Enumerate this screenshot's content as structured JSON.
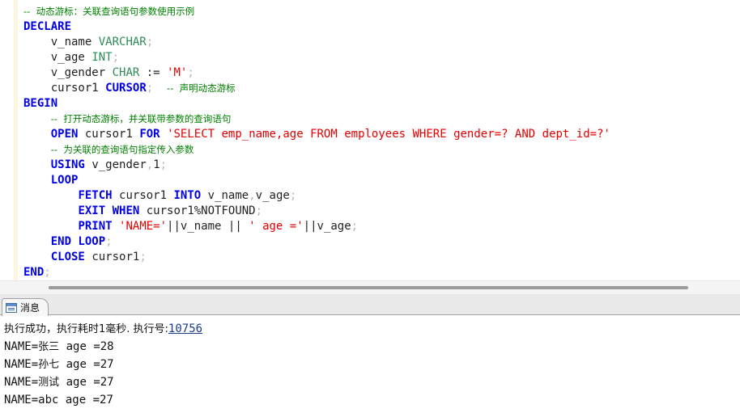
{
  "editor": {
    "lines": [
      "-- 动态游标：关联查询语句参数使用示例",
      "DECLARE",
      "    v_name VARCHAR;",
      "    v_age INT;",
      "    v_gender CHAR := 'M';",
      "    cursor1 CURSOR;  -- 声明动态游标",
      "BEGIN",
      "    -- 打开动态游标，并关联带参数的查询语句",
      "    OPEN cursor1 FOR 'SELECT emp_name,age FROM employees WHERE gender=? AND dept_id=?'",
      "    -- 为关联的查询语句指定传入参数",
      "    USING v_gender,1;",
      "    LOOP",
      "        FETCH cursor1 INTO v_name,v_age;",
      "        EXIT WHEN cursor1%NOTFOUND;",
      "        PRINT 'NAME='||v_name || ' age ='||v_age;",
      "    END LOOP;",
      "    CLOSE cursor1;",
      "END;"
    ],
    "tokens": {
      "c1": "--  动态游标：关联查询语句参数使用示例",
      "declare": "DECLARE",
      "v_name": "v_name",
      "varchar": "VARCHAR",
      "v_age": "v_age",
      "int": "INT",
      "v_gender": "v_gender",
      "char": "CHAR",
      "assign": ":=",
      "m_literal": "'M'",
      "cursor1": "cursor1",
      "cursor_kw": "CURSOR",
      "c2": "--  声明动态游标",
      "begin": "BEGIN",
      "c3": "--  打开动态游标，并关联带参数的查询语句",
      "open": "OPEN",
      "for": "FOR",
      "sql_literal": "'SELECT emp_name,age FROM employees WHERE gender=? AND dept_id=?'",
      "c4": "--  为关联的查询语句指定传入参数",
      "using": "USING",
      "one": "1",
      "loop": "LOOP",
      "fetch": "FETCH",
      "into": "INTO",
      "exit": "EXIT",
      "when": "WHEN",
      "notfound": "cursor1%NOTFOUND",
      "print": "PRINT",
      "name_literal": "'NAME='",
      "concat": "||",
      "age_literal": "' age ='",
      "end": "END",
      "close": "CLOSE",
      "semi": ";",
      "comma": ","
    }
  },
  "messages_tab": {
    "label": "消息"
  },
  "messages": {
    "status_prefix": "执行成功，执行耗时1毫秒. 执行号:",
    "exec_number": "10756",
    "results": [
      {
        "prefix": "NAME=",
        "name": "张三",
        "rest": " age =28"
      },
      {
        "prefix": "NAME=",
        "name": "孙七",
        "rest": " age =27"
      },
      {
        "prefix": "NAME=",
        "name": "测试",
        "rest": " age =27"
      },
      {
        "prefix": "NAME=",
        "name": "abc",
        "rest": " age =27"
      }
    ]
  },
  "colors": {
    "keyword": "#0000e6",
    "type": "#2e8b57",
    "string": "#e60000",
    "comment": "#008000",
    "punctuation": "#b8b8b8",
    "link": "#1a3b8a"
  }
}
